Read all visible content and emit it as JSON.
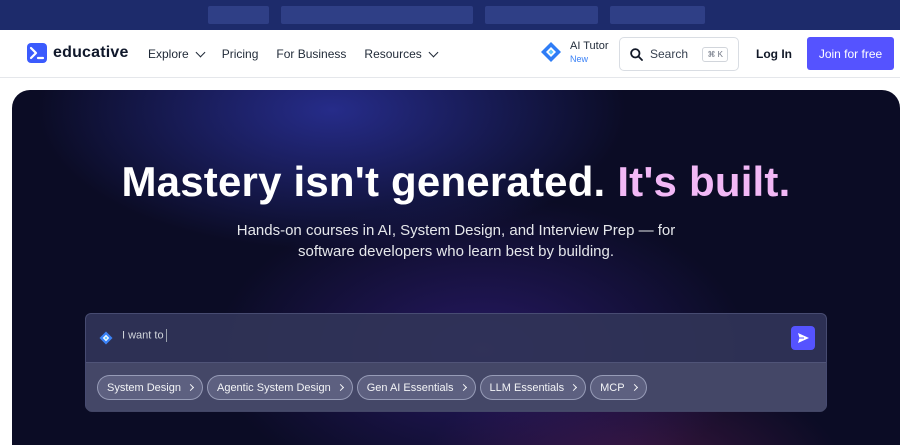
{
  "nav": {
    "logo_text": "educative",
    "links": [
      {
        "label": "Explore",
        "has_dropdown": true
      },
      {
        "label": "Pricing",
        "has_dropdown": false
      },
      {
        "label": "For Business",
        "has_dropdown": false
      },
      {
        "label": "Resources",
        "has_dropdown": true
      }
    ],
    "ai_tutor": {
      "label": "AI Tutor",
      "badge": "New"
    },
    "search": {
      "label": "Search",
      "shortcut": "⌘ K"
    },
    "login_label": "Log In",
    "join_label": "Join for free"
  },
  "hero": {
    "title_main": "Mastery isn't generated.",
    "title_accent": "It's built.",
    "subtitle_line1": "Hands-on courses in AI, System Design, and Interview Prep — for",
    "subtitle_line2": "software developers who learn best by building.",
    "prompt": {
      "placeholder": "I want to",
      "chips": [
        "System Design",
        "Agentic System Design",
        "Gen AI Essentials",
        "LLM Essentials",
        "MCP"
      ]
    }
  },
  "colors": {
    "brand": "#5553ff",
    "accent_text": "#f2b8f6",
    "hero_bg": "#0b0c25",
    "promo_strip": "#1d2b6b"
  }
}
